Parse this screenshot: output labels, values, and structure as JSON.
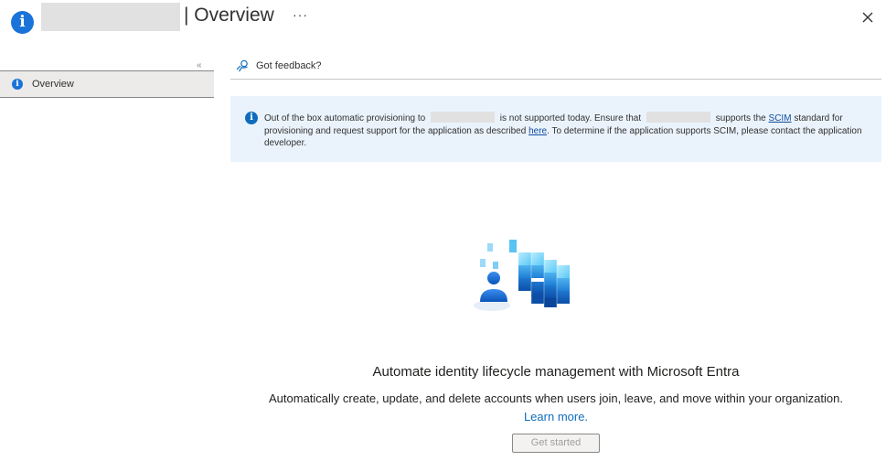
{
  "header": {
    "title": "| Overview",
    "more_label": "···"
  },
  "sidebar": {
    "collapse_label": "«",
    "items": [
      {
        "label": "Overview",
        "icon": "info-icon"
      }
    ]
  },
  "commandbar": {
    "feedback_label": "Got feedback?",
    "feedback_icon": "feedback-icon"
  },
  "banner": {
    "part1": "Out of the box automatic provisioning to",
    "part2": "is not supported today. Ensure that",
    "part3": "supports the",
    "scim_link": "SCIM",
    "part4": "standard for provisioning and request support for the application as described",
    "here_link": "here",
    "part5": ". To determine if the application supports SCIM, please contact the application developer."
  },
  "empty_state": {
    "title": "Automate identity lifecycle management with Microsoft Entra",
    "description": "Automatically create, update, and delete accounts when users join, leave, and move within your organization.",
    "learn_more": "Learn more.",
    "get_started": "Get started"
  },
  "colors": {
    "accent": "#0f6cbd",
    "banner_bg": "#eaf3fc",
    "nav_selected_bg": "#edebe9"
  }
}
